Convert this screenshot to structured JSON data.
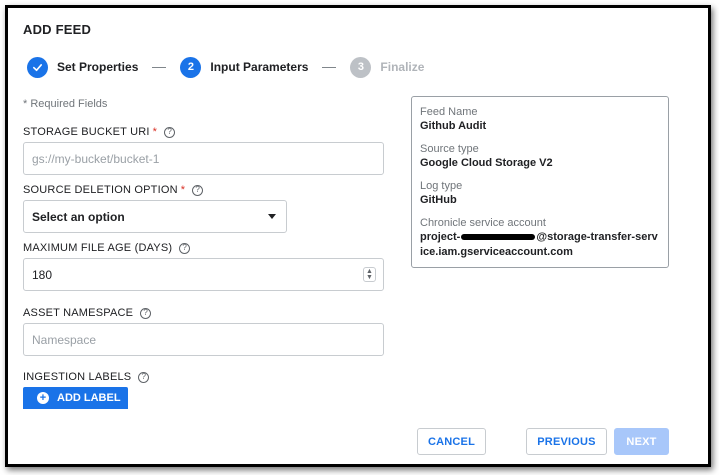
{
  "dialog": {
    "title": "ADD FEED"
  },
  "stepper": {
    "steps": [
      {
        "number": "1",
        "label": "Set Properties",
        "state": "done"
      },
      {
        "number": "2",
        "label": "Input Parameters",
        "state": "active"
      },
      {
        "number": "3",
        "label": "Finalize",
        "state": "pending"
      }
    ]
  },
  "form": {
    "required_note": "* Required Fields",
    "storage_bucket_uri": {
      "label": "STORAGE BUCKET URI",
      "required": "*",
      "placeholder": "gs://my-bucket/bucket-1",
      "value": ""
    },
    "source_deletion_option": {
      "label": "SOURCE DELETION OPTION",
      "required": "*",
      "selected": "Select an option"
    },
    "maximum_file_age": {
      "label": "MAXIMUM FILE AGE (DAYS)",
      "value": "180"
    },
    "asset_namespace": {
      "label": "ASSET NAMESPACE",
      "placeholder": "Namespace",
      "value": ""
    },
    "ingestion_labels": {
      "label": "INGESTION LABELS",
      "add_button": "ADD LABEL"
    },
    "help_glyph": "?"
  },
  "summary": {
    "feed_name_label": "Feed Name",
    "feed_name": "Github Audit",
    "source_type_label": "Source type",
    "source_type": "Google Cloud Storage V2",
    "log_type_label": "Log type",
    "log_type": "GitHub",
    "service_account_label": "Chronicle service account",
    "service_account_prefix": "project-",
    "service_account_suffix": "@storage-transfer-service.iam.gserviceaccount.com"
  },
  "footer": {
    "cancel": "CANCEL",
    "previous": "PREVIOUS",
    "next": "NEXT"
  },
  "colors": {
    "accent": "#1a73e8",
    "required": "#d93025",
    "pending": "#bdc1c6",
    "disabled_button": "#a8c7fa"
  },
  "icons": {
    "done_step": "check-icon",
    "add": "plus-circle-icon",
    "help": "help-circle-icon",
    "dropdown": "caret-down-icon",
    "spinner": "number-spinner-icon"
  }
}
